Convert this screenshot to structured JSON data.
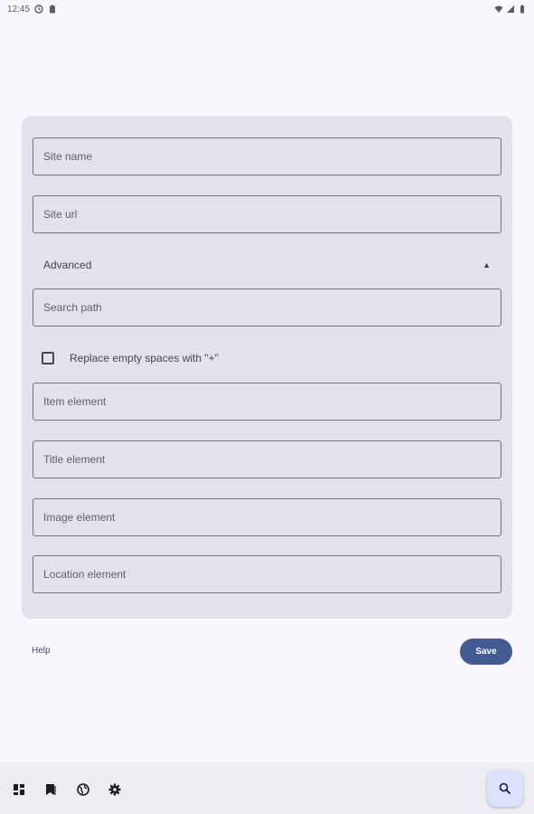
{
  "status_bar": {
    "time": "12:45"
  },
  "form": {
    "site_name_placeholder": "Site name",
    "site_url_placeholder": "Site url",
    "advanced_label": "Advanced",
    "advanced_chevron": "▲",
    "search_path_placeholder": "Search path",
    "replace_spaces_label": "Replace empty spaces with \"+\"",
    "replace_spaces_checked": false,
    "item_element_placeholder": "Item element",
    "title_element_placeholder": "Title element",
    "image_element_placeholder": "Image element",
    "location_element_placeholder": "Location element"
  },
  "actions": {
    "help_label": "Help",
    "save_label": "Save"
  },
  "bottom_nav": {
    "icons": [
      "dashboard-icon",
      "bookmarks-icon",
      "globe-icon",
      "settings-icon"
    ],
    "fab_icon": "search-icon"
  },
  "colors": {
    "background": "#fbf8fd",
    "card": "#e3e2ec",
    "primary": "#445b92",
    "fab": "#dae2ff",
    "bottom_bar": "#eeedf4"
  }
}
